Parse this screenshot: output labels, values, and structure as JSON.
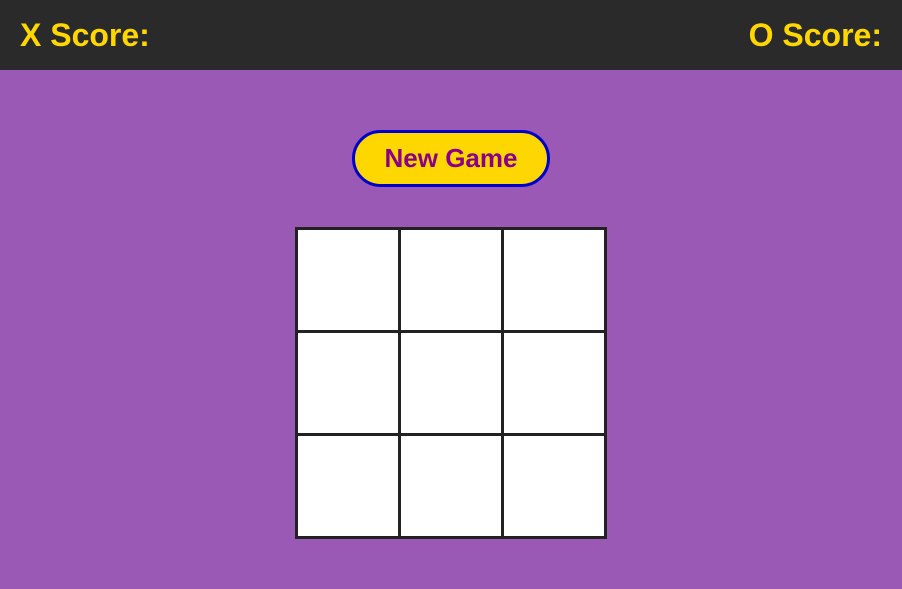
{
  "header": {
    "x_score_label": "X Score:",
    "o_score_label": "O Score:",
    "background_color": "#2a2a2a",
    "text_color": "#FFD700"
  },
  "game": {
    "new_game_button_label": "New Game",
    "board": {
      "cells": [
        "",
        "",
        "",
        "",
        "",
        "",
        "",
        "",
        ""
      ]
    },
    "background_color": "#9B59B6",
    "board_border_color": "#222222",
    "cell_bg_color": "#ffffff"
  }
}
